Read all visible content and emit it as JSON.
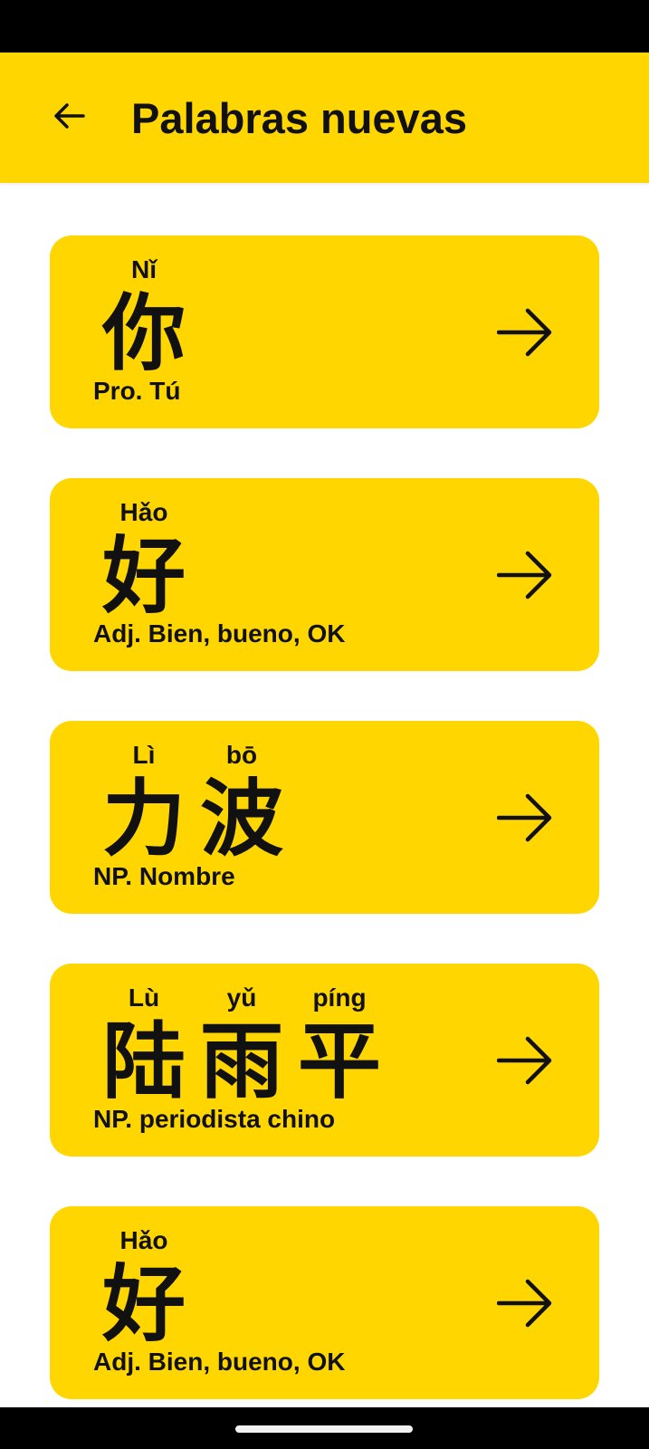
{
  "colors": {
    "accent": "#FFD600",
    "text": "#111111",
    "status_bar": "#000000",
    "background": "#FFFFFF"
  },
  "header": {
    "title": "Palabras nuevas",
    "back_icon": "arrow-left-icon"
  },
  "words": [
    {
      "characters": [
        {
          "pinyin": "Nǐ",
          "hanzi": "你"
        }
      ],
      "meaning": "Pro. Tú",
      "icon": "arrow-right-icon"
    },
    {
      "characters": [
        {
          "pinyin": "Hǎo",
          "hanzi": "好"
        }
      ],
      "meaning": "Adj. Bien, bueno, OK",
      "icon": "arrow-right-icon"
    },
    {
      "characters": [
        {
          "pinyin": "Lì",
          "hanzi": "力"
        },
        {
          "pinyin": "bō",
          "hanzi": "波"
        }
      ],
      "meaning": "NP. Nombre",
      "icon": "arrow-right-icon"
    },
    {
      "characters": [
        {
          "pinyin": "Lù",
          "hanzi": "陆"
        },
        {
          "pinyin": "yǔ",
          "hanzi": "雨"
        },
        {
          "pinyin": "píng",
          "hanzi": "平"
        }
      ],
      "meaning": "NP. periodista chino",
      "icon": "arrow-right-icon"
    },
    {
      "characters": [
        {
          "pinyin": "Hǎo",
          "hanzi": "好"
        }
      ],
      "meaning": "Adj. Bien, bueno, OK",
      "icon": "arrow-right-icon"
    }
  ]
}
